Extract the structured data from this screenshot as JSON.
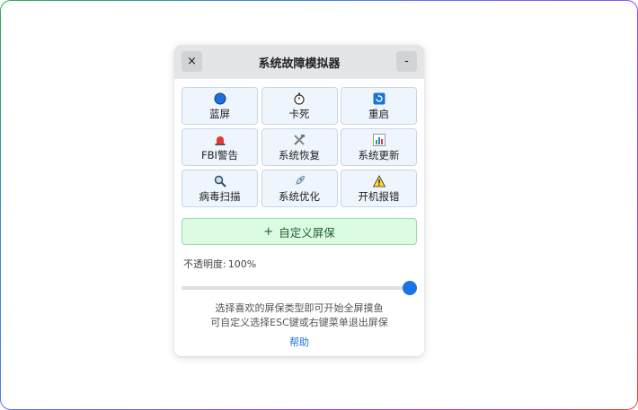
{
  "window": {
    "title": "系统故障模拟器",
    "close_label": "×",
    "min_label": "-"
  },
  "tiles": [
    {
      "label": "蓝屏",
      "icon": "blue-circle-icon"
    },
    {
      "label": "卡死",
      "icon": "stopwatch-icon"
    },
    {
      "label": "重启",
      "icon": "restart-icon"
    },
    {
      "label": "FBI警告",
      "icon": "siren-icon"
    },
    {
      "label": "系统恢复",
      "icon": "tools-icon"
    },
    {
      "label": "系统更新",
      "icon": "bar-chart-icon"
    },
    {
      "label": "病毒扫描",
      "icon": "magnifier-icon"
    },
    {
      "label": "系统优化",
      "icon": "rocket-icon"
    },
    {
      "label": "开机报错",
      "icon": "warning-icon"
    }
  ],
  "custom": {
    "plus": "+",
    "label": "自定义屏保"
  },
  "opacity": {
    "label": "不透明度:",
    "value_text": "100%",
    "value": 100
  },
  "hints": {
    "line1": "选择喜欢的屏保类型即可开始全屏摸鱼",
    "line2": "可自定义选择ESC键或右键菜单退出屏保"
  },
  "help": "帮助",
  "colors": {
    "accent": "#1a73e8",
    "tile_bg": "#eff5fc",
    "custom_bg": "#dcfbe3"
  }
}
